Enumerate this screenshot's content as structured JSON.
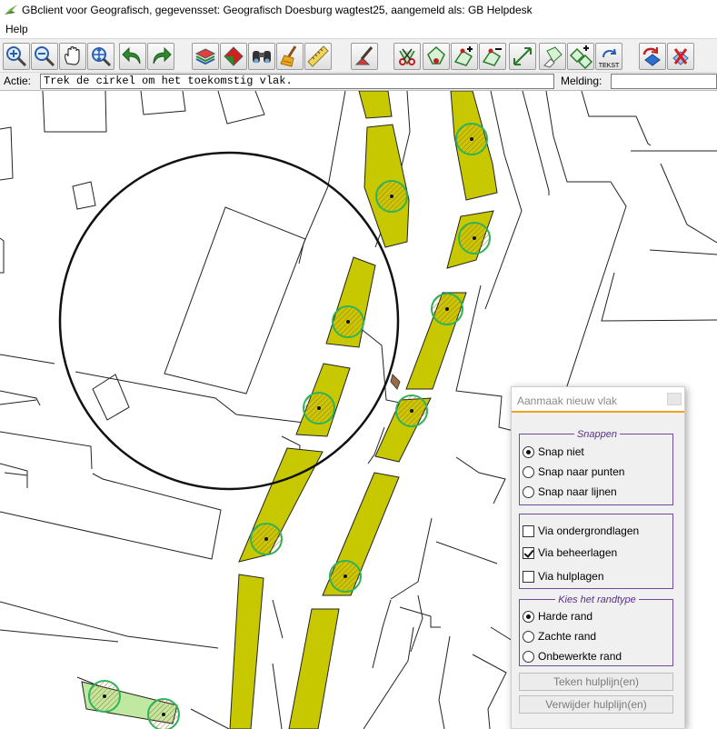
{
  "window": {
    "title": "GBclient voor Geografisch, gegevensset: Geografisch Doesburg wagtest25, aangemeld als: GB Helpdesk"
  },
  "menu": {
    "items": [
      "Help"
    ]
  },
  "toolbar": {
    "buttons": [
      {
        "icon": "zoom-in-icon"
      },
      {
        "icon": "zoom-out-icon"
      },
      {
        "icon": "pan-hand-icon"
      },
      {
        "icon": "zoom-extent-icon"
      },
      {
        "icon": "undo-arrow-icon"
      },
      {
        "icon": "redo-arrow-icon"
      },
      {
        "icon": "layers-icon"
      },
      {
        "icon": "red-polygon-icon"
      },
      {
        "icon": "binoculars-icon"
      },
      {
        "icon": "broom-icon"
      },
      {
        "icon": "ruler-icon"
      },
      {
        "icon": "edit-tool-icon"
      },
      {
        "icon": "cut-icon"
      },
      {
        "icon": "select-point-icon"
      },
      {
        "icon": "add-vertex-icon"
      },
      {
        "icon": "remove-vertex-icon"
      },
      {
        "icon": "move-line-icon"
      },
      {
        "icon": "eraser-icon"
      },
      {
        "icon": "add-polygon-icon"
      },
      {
        "icon": "text-icon",
        "label": "TEKST"
      },
      {
        "icon": "undo-red-icon"
      },
      {
        "icon": "delete-icon"
      }
    ]
  },
  "action_bar": {
    "actie_label": "Actie:",
    "actie_value": "Trek de cirkel om het toekomstig vlak.",
    "melding_label": "Melding:",
    "melding_value": ""
  },
  "panel": {
    "title": "Aanmaak nieuw vlak",
    "snappen": {
      "legend": "Snappen",
      "options": [
        {
          "label": "Snap niet",
          "selected": true
        },
        {
          "label": "Snap naar punten",
          "selected": false
        },
        {
          "label": "Snap naar lijnen",
          "selected": false
        }
      ]
    },
    "layers": {
      "options": [
        {
          "label": "Via ondergrondlagen",
          "checked": false
        },
        {
          "label": "Via beheerlagen",
          "checked": true
        },
        {
          "label": "Via hulplagen",
          "checked": false
        }
      ]
    },
    "randtype": {
      "legend": "Kies het randtype",
      "options": [
        {
          "label": "Harde rand",
          "selected": true
        },
        {
          "label": "Zachte rand",
          "selected": false
        },
        {
          "label": "Onbewerkte rand",
          "selected": false
        }
      ]
    },
    "buttons": {
      "teken": "Teken hulplijn(en)",
      "verwijder": "Verwijder hulplijn(en)"
    }
  },
  "colors": {
    "strip_fill": "#c8c800",
    "tree_ring": "#2fb35a",
    "panel_accent": "#f2a024",
    "group_border": "#6e4b9a"
  }
}
